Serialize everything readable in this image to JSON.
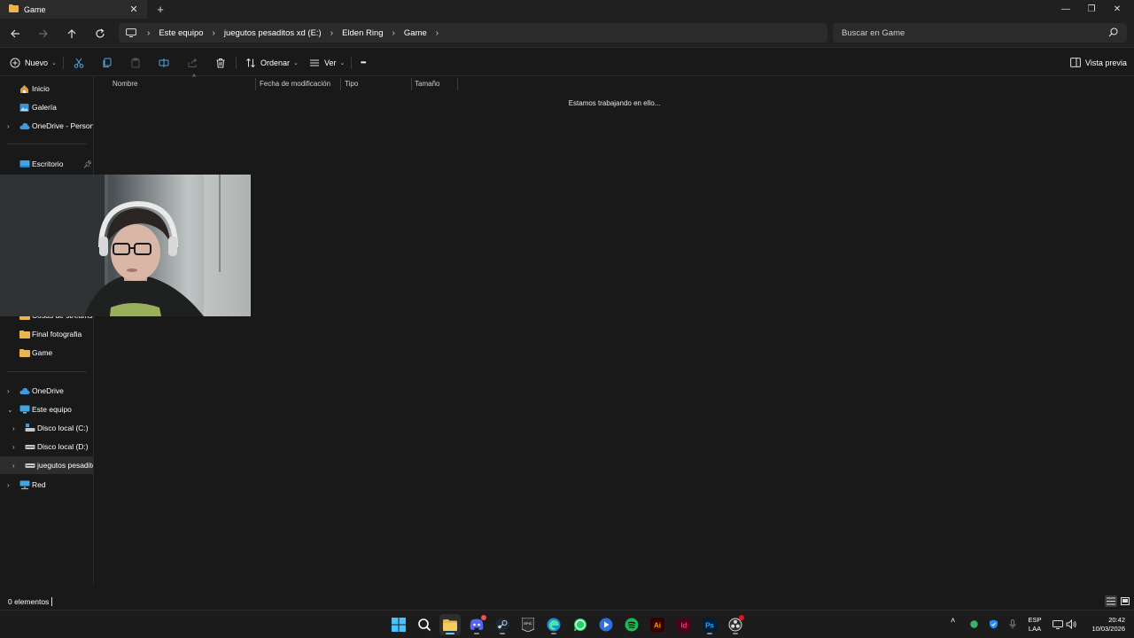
{
  "window": {
    "tab_title": "Game",
    "close_tab_glyph": "✕",
    "new_tab_glyph": "+",
    "minimize_glyph": "—",
    "restore_glyph": "❐",
    "close_glyph": "✕"
  },
  "navigation": {
    "breadcrumb": [
      "Este equipo",
      "juegutos pesaditos xd (E:)",
      "Elden Ring",
      "Game"
    ],
    "search_placeholder": "Buscar en Game"
  },
  "toolbar": {
    "new_label": "Nuevo",
    "sort_label": "Ordenar",
    "view_label": "Ver",
    "more_glyph": "•••",
    "preview_label": "Vista previa"
  },
  "sidebar": {
    "top": [
      {
        "label": "Inicio",
        "icon": "home-icon"
      },
      {
        "label": "Galería",
        "icon": "gallery-icon"
      },
      {
        "label": "OneDrive - Persona",
        "icon": "cloud-icon"
      }
    ],
    "pinned": [
      {
        "label": "Escritorio",
        "icon": "desktop-icon"
      }
    ],
    "folders": [
      {
        "label": "Cosas de streams",
        "icon": "folder-icon"
      },
      {
        "label": "Final fotografia",
        "icon": "folder-icon"
      },
      {
        "label": "Game",
        "icon": "folder-icon"
      }
    ],
    "tree": [
      {
        "label": "OneDrive",
        "icon": "cloud-icon"
      },
      {
        "label": "Este equipo",
        "icon": "pc-icon"
      },
      {
        "label": "Disco local (C:)",
        "icon": "drive-icon"
      },
      {
        "label": "Disco local (D:)",
        "icon": "drive-icon"
      },
      {
        "label": "juegutos pesaditos",
        "icon": "drive-icon"
      },
      {
        "label": "Red",
        "icon": "network-icon"
      }
    ]
  },
  "content": {
    "columns": [
      "Nombre",
      "Fecha de modificación",
      "Tipo",
      "Tamaño"
    ],
    "loading_message": "Estamos trabajando en ello..."
  },
  "status": {
    "item_count": "0 elementos"
  },
  "taskbar": {
    "apps": [
      "start",
      "search",
      "file-explorer",
      "discord",
      "steam",
      "epic-games",
      "edge",
      "whatsapp",
      "app",
      "spotify",
      "illustrator",
      "indesign",
      "photoshop",
      "obs"
    ],
    "language": "ESP",
    "layout": "LAA",
    "time": "20:42",
    "date": "10/03/2026"
  },
  "colors": {
    "accent": "#60cdff",
    "folder": "#e8b64c",
    "background": "#191919"
  }
}
